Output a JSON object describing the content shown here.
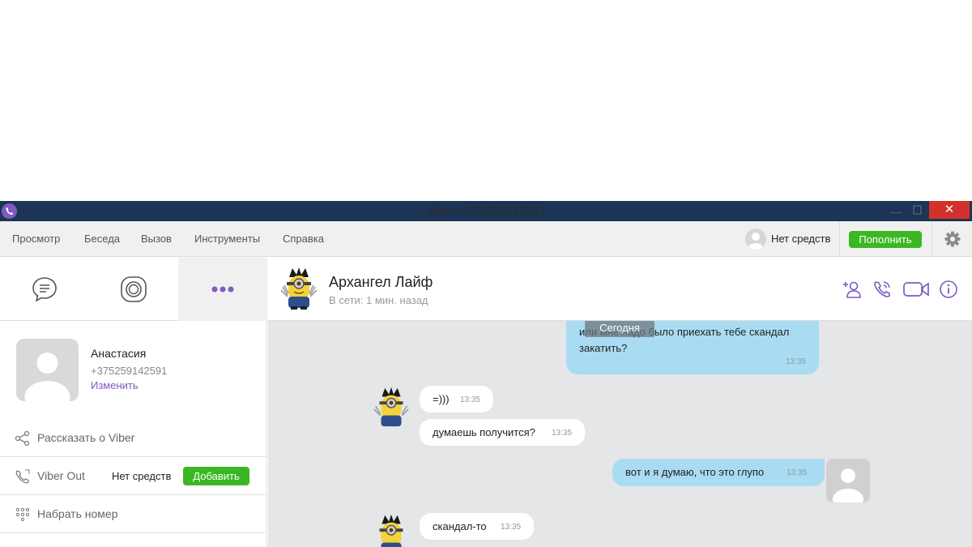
{
  "window": {
    "title": "Viber +375259142591",
    "close_glyph": "✕",
    "minimize_glyph": "—"
  },
  "menu": {
    "items": [
      "Просмотр",
      "Беседа",
      "Вызов",
      "Инструменты",
      "Справка"
    ],
    "balance": "Нет средств",
    "topup_label": "Пополнить"
  },
  "profile": {
    "name": "Анастасия",
    "phone": "+375259142591",
    "edit_label": "Изменить"
  },
  "left_menu": {
    "tell_about": "Рассказать о Viber",
    "viber_out": "Viber Out",
    "viber_out_status": "Нет средств",
    "add_label": "Добавить",
    "dial": "Набрать номер"
  },
  "contact": {
    "name": "Архангел Лайф",
    "status": "В сети: 1 мин. назад"
  },
  "chat": {
    "date_chip": "Сегодня",
    "messages": [
      {
        "dir": "out",
        "text_line1": "или мне надо было приехать тебе скандал",
        "text_line2": "закатить?",
        "time": "13:35"
      },
      {
        "dir": "in",
        "text": "=)))",
        "time": "13:35"
      },
      {
        "dir": "in",
        "text": "думаешь получится?",
        "time": "13:35"
      },
      {
        "dir": "out",
        "text": "вот и я думаю, что это глупо",
        "time": "13:35"
      },
      {
        "dir": "in",
        "text": "скандал-то",
        "time": "13:35"
      }
    ]
  },
  "colors": {
    "titlebar": "#1c3556",
    "accent_purple": "#7d5bbf",
    "green": "#3cb724",
    "close_red": "#d2322a",
    "outgoing_bubble": "#a9dcf2",
    "chat_bg": "#e4e6e7"
  },
  "icons": [
    "viber-logo-icon",
    "chat-icon",
    "stories-icon",
    "more-icon",
    "share-icon",
    "phone-out-icon",
    "dialpad-icon",
    "add-contact-icon",
    "call-icon",
    "video-icon",
    "info-icon",
    "gear-icon"
  ]
}
